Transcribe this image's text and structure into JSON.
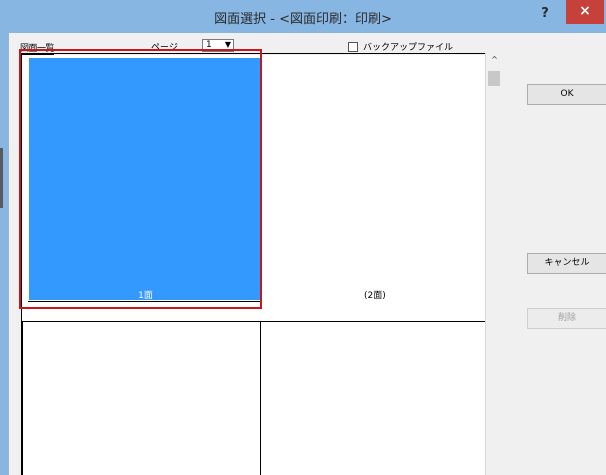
{
  "window": {
    "title": "図面選択 - <図面印刷：印刷>",
    "help_label": "?",
    "close_label": "×"
  },
  "header": {
    "list_label": "図面一覧",
    "page_label": "ページ",
    "page_value": "1",
    "page_dropdown_arrow": "▼",
    "backup_label": "バックアップファイル",
    "backup_checked": false
  },
  "thumbnails": [
    {
      "label": "1面",
      "selected": true
    },
    {
      "label": "(2面)",
      "selected": false
    }
  ],
  "scrollbar": {
    "up_arrow": "^"
  },
  "buttons": {
    "ok": "OK",
    "cancel": "キャンセル",
    "delete": "削除"
  },
  "colors": {
    "title_bar": "#87b6e2",
    "selected_thumb": "#3399ff",
    "selection_border": "#c8161d",
    "close_button": "#c7413b"
  }
}
